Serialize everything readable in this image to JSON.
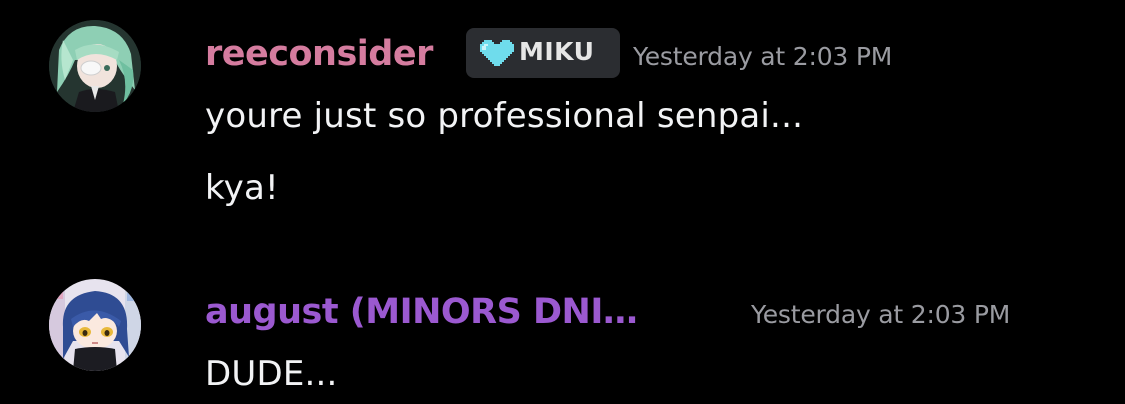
{
  "messages": [
    {
      "username": "reeconsider",
      "username_color": "#d57c9f",
      "avatar": "anime-avatar-green-hair",
      "tag": {
        "icon": "pixel-heart-icon",
        "icon_color": "#6fdcec",
        "label": "MIKU"
      },
      "timestamp": "Yesterday at 2:03 PM",
      "lines": [
        "youre just so professional senpai...",
        "kya!"
      ]
    },
    {
      "username": "august (MINORS DNI…",
      "username_color": "#9b59d0",
      "avatar": "anime-avatar-blue-hair",
      "timestamp": "Yesterday at 2:03 PM",
      "lines": [
        "DUDE..."
      ]
    }
  ],
  "colors": {
    "background": "#000000",
    "timestamp": "#9a9ba1",
    "message_text": "#f2f3f5",
    "tag_background": "#2b2d31"
  }
}
